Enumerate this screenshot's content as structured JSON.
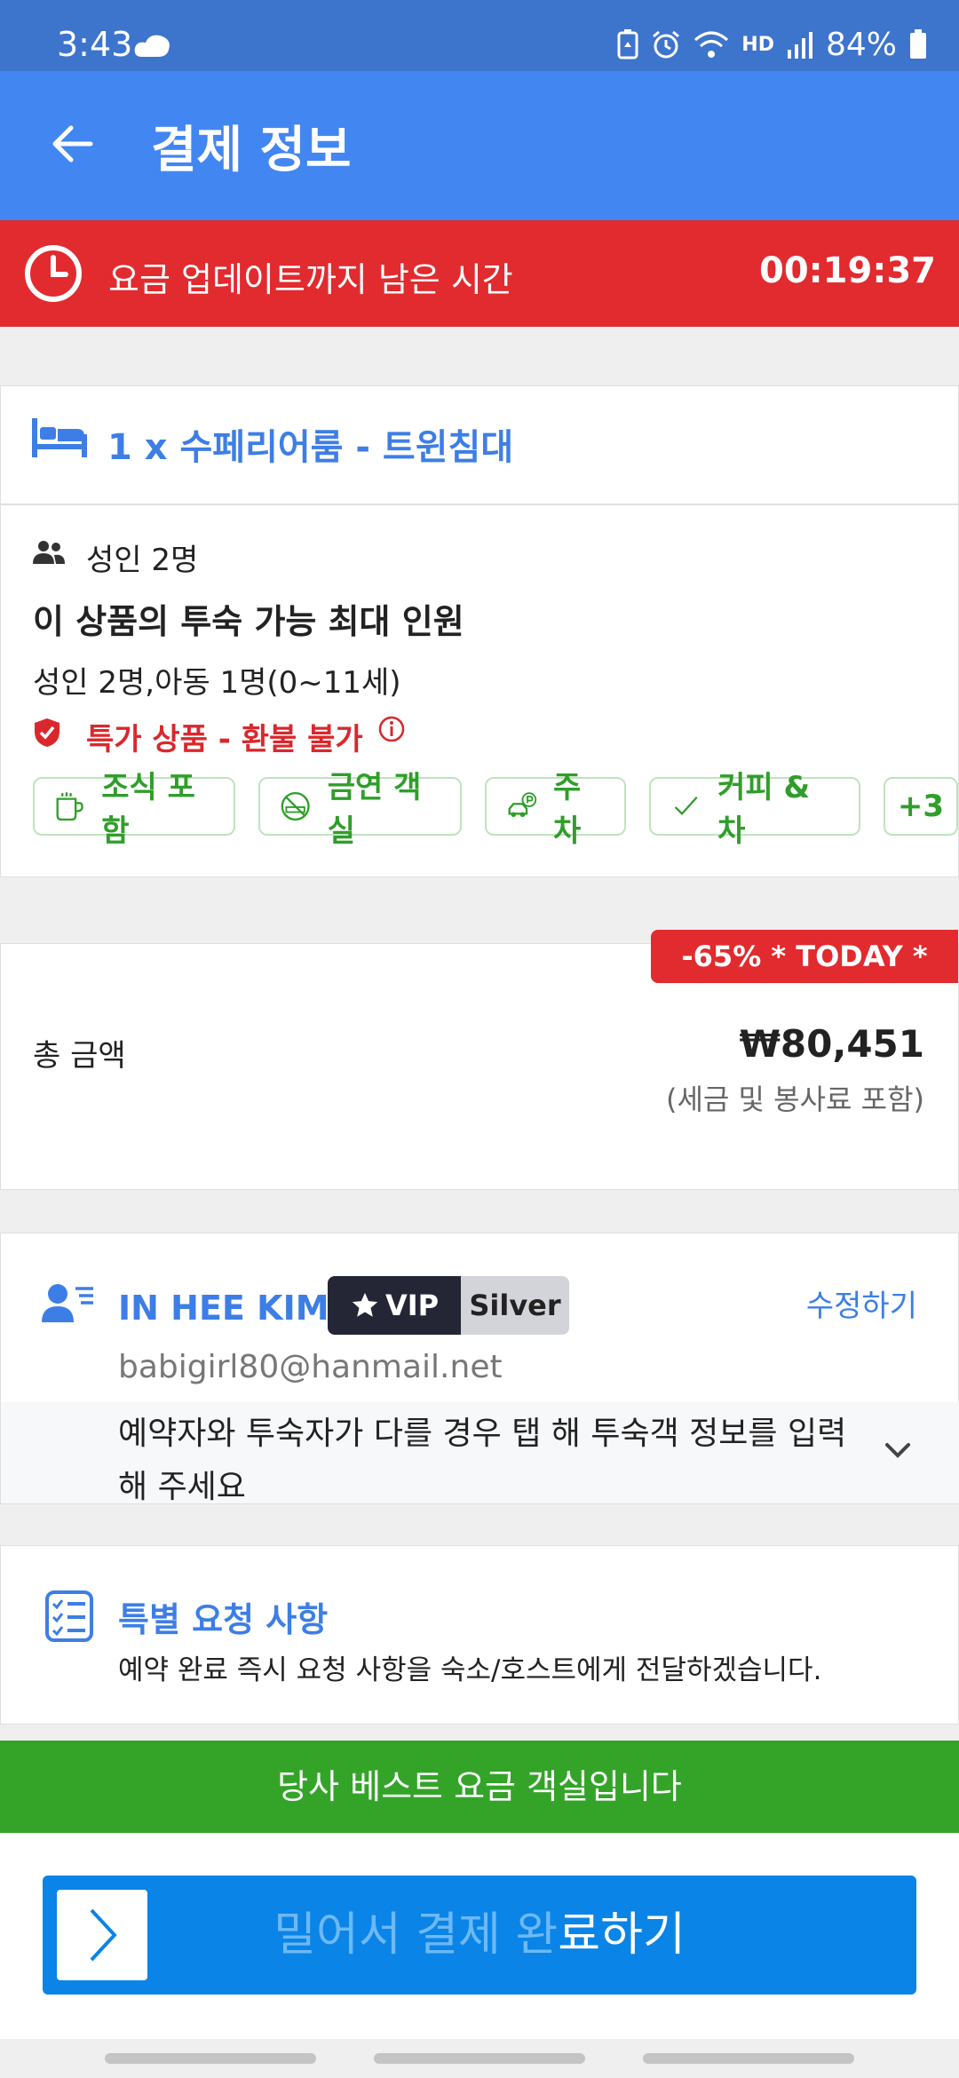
{
  "status_bar": {
    "time": "3:43",
    "battery_percent": "84%",
    "network_label": "HD"
  },
  "header": {
    "title": "결제 정보"
  },
  "timer_bar": {
    "label": "요금 업데이트까지 남은 시간",
    "countdown": "00:19:37"
  },
  "room": {
    "name": "1 x 수페리어룸 - 트윈침대",
    "guests": "성인 2명",
    "max_occupancy_title": "이 상품의 투숙 가능 최대 인원",
    "max_occupancy_detail": "성인 2명,아동 1명(0~11세)",
    "refund_policy": "특가 상품 - 환불 불가",
    "amenities": [
      {
        "label": "조식 포함",
        "icon": "coffee-cup-icon"
      },
      {
        "label": "금연 객실",
        "icon": "no-smoking-icon"
      },
      {
        "label": "주차",
        "icon": "parking-car-icon"
      },
      {
        "label": "커피 & 차",
        "icon": "checkmark-icon"
      },
      {
        "label": "+3",
        "icon": ""
      }
    ]
  },
  "price": {
    "discount_badge": "-65% * TODAY *",
    "label": "총 금액",
    "amount": "₩80,451",
    "tax_note": "(세금 및 봉사료 포함)"
  },
  "guest": {
    "name": "IN HEE KIM",
    "vip_label": "VIP",
    "tier": "Silver",
    "edit_label": "수정하기",
    "email": "babigirl80@hanmail.net",
    "hint": "예약자와 투숙자가 다를 경우 탭 해 투숙객 정보를 입력해 주세요"
  },
  "special_requests": {
    "title": "특별 요청 사항",
    "description": "예약 완료 즉시 요청 사항을 숙소/호스트에게 전달하겠습니다."
  },
  "best_rate_banner": "당사 베스트 요금 객실입니다",
  "pay_slider": {
    "label_dim": "밀어서 결제 완",
    "label_bright": "료하기"
  },
  "colors": {
    "header_blue": "#4286f1",
    "timer_red": "#e12b2f",
    "link_blue": "#3d7ee6",
    "amenity_green": "#2f9e2a",
    "banner_green": "#34a429",
    "slider_blue": "#0a84e6"
  }
}
